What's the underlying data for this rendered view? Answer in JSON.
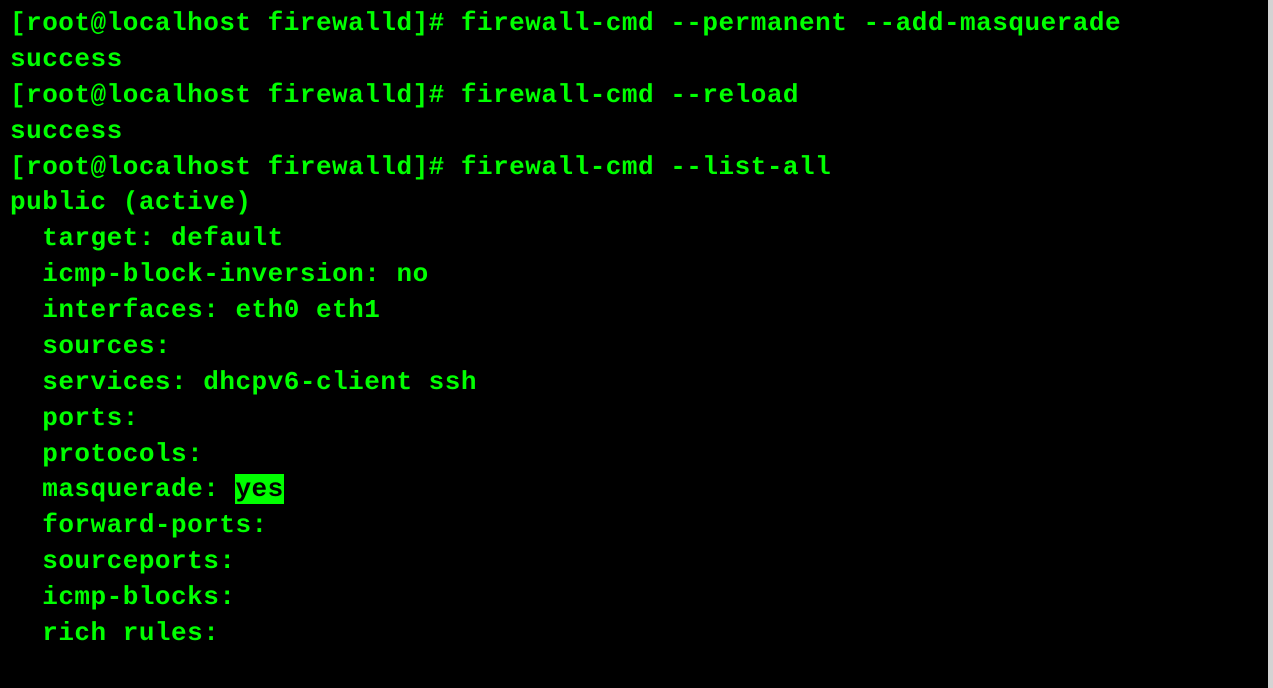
{
  "terminal": {
    "prompt": "[root@localhost firewalld]# ",
    "command1": "firewall-cmd --permanent --add-masquerade",
    "result1": "success",
    "command2": "firewall-cmd --reload",
    "result2": "success",
    "command3": "firewall-cmd --list-all",
    "output": {
      "zone_line": "public (active)",
      "target": "  target: default",
      "icmp_inversion": "  icmp-block-inversion: no",
      "interfaces": "  interfaces: eth0 eth1",
      "sources": "  sources:",
      "services": "  services: dhcpv6-client ssh",
      "ports": "  ports:",
      "protocols": "  protocols:",
      "masquerade_label": "  masquerade: ",
      "masquerade_value": "yes",
      "forward_ports": "  forward-ports:",
      "sourceports": "  sourceports:",
      "icmp_blocks": "  icmp-blocks:",
      "rich_rules": "  rich rules:"
    }
  }
}
